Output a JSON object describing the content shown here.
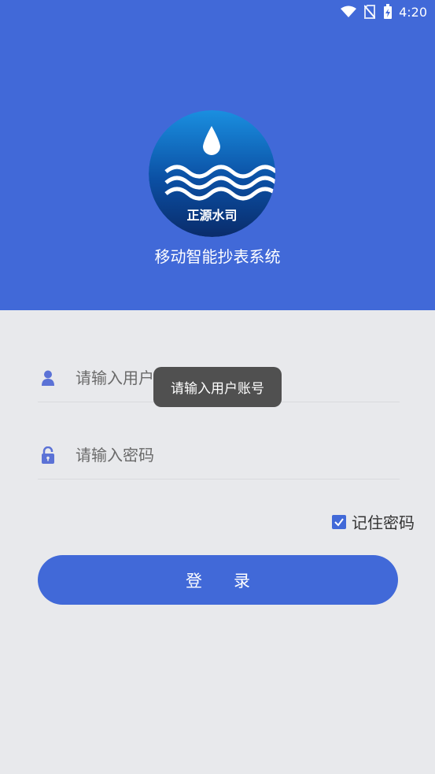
{
  "status_bar": {
    "time": "4:20"
  },
  "brand": {
    "logo_text": "正源水司",
    "app_title": "移动智能抄表系统"
  },
  "login_form": {
    "username_placeholder": "请输入用户账号",
    "password_placeholder": "请输入密码",
    "remember_label": "记住密码",
    "remember_checked": true,
    "login_label": "登录"
  },
  "toast": {
    "message": "请输入用户账号"
  },
  "colors": {
    "primary": "#4169d8",
    "background": "#e8e9ec",
    "toast": "#505050"
  }
}
